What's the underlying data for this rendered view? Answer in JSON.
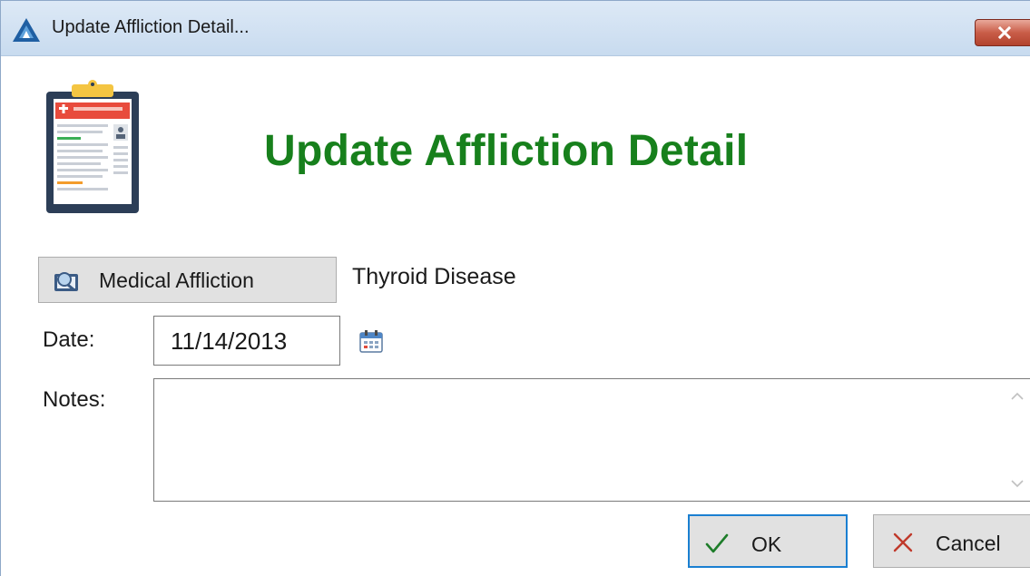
{
  "window": {
    "title": "Update Affliction Detail..."
  },
  "header": {
    "heading": "Update Affliction Detail"
  },
  "form": {
    "affliction_button_label": "Medical Affliction",
    "affliction_value": "Thyroid Disease",
    "date_label": "Date:",
    "date_value": "11/14/2013",
    "notes_label": "Notes:",
    "notes_value": ""
  },
  "buttons": {
    "ok_label": "OK",
    "cancel_label": "Cancel"
  },
  "colors": {
    "heading": "#17801c",
    "titlebar": "#c8dbef",
    "close_button": "#c95d48",
    "ok_focus_border": "#1a7fd1"
  },
  "icons": {
    "app": "app-logo-icon",
    "close": "close-icon",
    "header": "clipboard-icon",
    "affliction": "search-record-icon",
    "date": "calendar-icon",
    "ok": "checkmark-icon",
    "cancel": "x-icon"
  }
}
